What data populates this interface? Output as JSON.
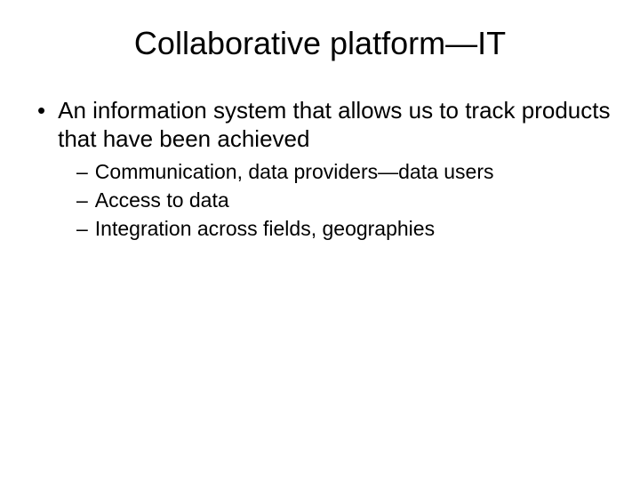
{
  "slide": {
    "title": "Collaborative platform—IT",
    "main_bullet": "An information system that allows us to track products that have been achieved",
    "sub_bullets": {
      "item0": "Communication, data providers—data users",
      "item1": "Access to data",
      "item2": "Integration across fields, geographies"
    }
  }
}
